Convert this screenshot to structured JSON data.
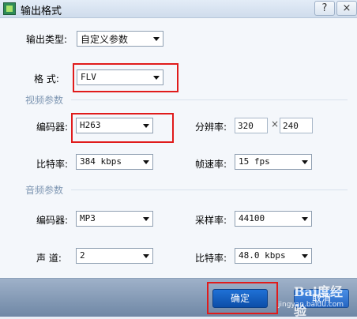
{
  "window": {
    "title": "输出格式",
    "help_label": "?",
    "close_label": "×"
  },
  "output_type": {
    "label": "输出类型:",
    "value": "自定义参数"
  },
  "format": {
    "label": "格  式:",
    "value": "FLV"
  },
  "video": {
    "section_label": "视频参数",
    "codec_label": "编码器:",
    "codec_value": "H263",
    "resolution_label": "分辨率:",
    "width": "320",
    "times": "×",
    "height": "240",
    "bitrate_label": "比特率:",
    "bitrate_value": "384 kbps",
    "framerate_label": "帧速率:",
    "framerate_value": "15 fps"
  },
  "audio": {
    "section_label": "音频参数",
    "codec_label": "编码器:",
    "codec_value": "MP3",
    "samplerate_label": "采样率:",
    "samplerate_value": "44100",
    "channel_label": "声  道:",
    "channel_value": "2",
    "bitrate_label": "比特率:",
    "bitrate_value": "48.0 kbps"
  },
  "buttons": {
    "ok": "确定",
    "cancel": "取消"
  },
  "watermark": {
    "main": "Bai度经验",
    "sub": "jingyan.baidu.com"
  },
  "colors": {
    "highlight": "#e01b1b",
    "ok_button": "#1565c8",
    "group_label": "#7f97b3"
  }
}
